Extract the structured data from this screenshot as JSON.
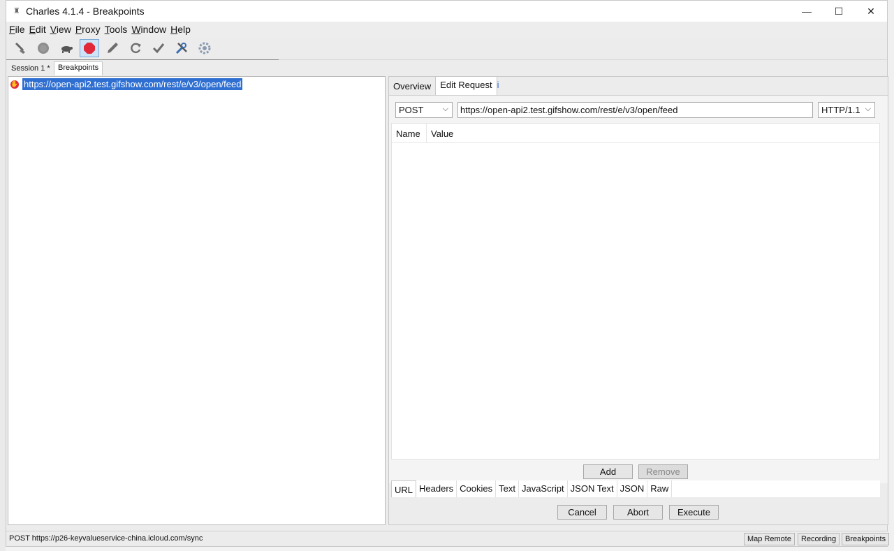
{
  "window": {
    "title": "Charles 4.1.4 - Breakpoints",
    "controls": {
      "minimize": "—",
      "maximize": "☐",
      "close": "✕"
    }
  },
  "menubar": [
    {
      "label": "File",
      "mnemonic": "F",
      "rest": "ile"
    },
    {
      "label": "Edit",
      "mnemonic": "E",
      "rest": "dit"
    },
    {
      "label": "View",
      "mnemonic": "V",
      "rest": "iew"
    },
    {
      "label": "Proxy",
      "mnemonic": "P",
      "rest": "roxy"
    },
    {
      "label": "Tools",
      "mnemonic": "T",
      "rest": "ools"
    },
    {
      "label": "Window",
      "mnemonic": "W",
      "rest": "indow"
    },
    {
      "label": "Help",
      "mnemonic": "H",
      "rest": "elp"
    }
  ],
  "toolbar": {
    "icons": [
      "broom-icon",
      "record-icon",
      "turtle-icon",
      "breakpoint-icon",
      "pen-icon",
      "refresh-icon",
      "check-icon",
      "tools-icon",
      "gear-icon"
    ],
    "active": "breakpoint-icon"
  },
  "session_tabs": [
    {
      "label": "Session 1 *"
    },
    {
      "label": "Breakpoints"
    }
  ],
  "breakpoint_list": {
    "items": [
      {
        "url": "https://open-api2.test.gifshow.com/rest/e/v3/open/feed"
      }
    ]
  },
  "right_tabs": {
    "tabs": [
      "Overview",
      "Edit Request"
    ],
    "selected": "Edit Request",
    "extra": "i"
  },
  "request": {
    "method": "POST",
    "url": "https://open-api2.test.gifshow.com/rest/e/v3/open/feed",
    "protocol": "HTTP/1.1"
  },
  "params_table": {
    "headers": [
      "Name",
      "Value"
    ]
  },
  "param_buttons": {
    "add": "Add",
    "remove": "Remove"
  },
  "sub_tabs": {
    "tabs": [
      "URL",
      "Headers",
      "Cookies",
      "Text",
      "JavaScript",
      "JSON Text",
      "JSON",
      "Raw"
    ],
    "selected": "URL"
  },
  "actions": {
    "cancel": "Cancel",
    "abort": "Abort",
    "execute": "Execute"
  },
  "status": {
    "text": "POST https://p26-keyvalueservice-china.icloud.com/sync",
    "buttons": [
      "Map Remote",
      "Recording",
      "Breakpoints"
    ]
  }
}
